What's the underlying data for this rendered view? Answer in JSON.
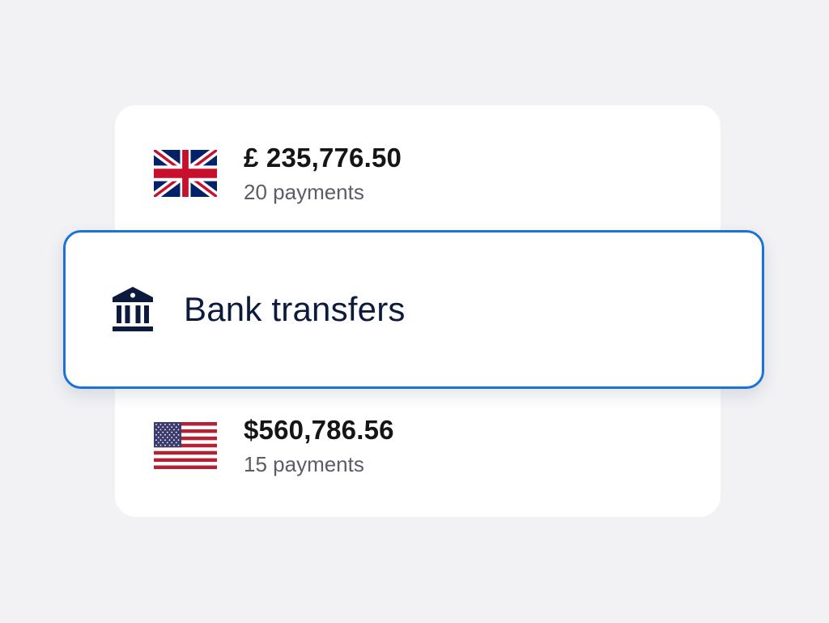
{
  "accounts": [
    {
      "flag": "uk-flag-icon",
      "amount": "£ 235,776.50",
      "payments": "20 payments"
    },
    {
      "flag": "us-flag-icon",
      "amount": "$560,786.56",
      "payments": "15 payments"
    }
  ],
  "payment_method": {
    "icon": "bank-icon",
    "label": "Bank transfers"
  },
  "colors": {
    "background": "#f2f2f5",
    "card": "#ffffff",
    "selected_border": "#1a73d9",
    "bank_icon": "#0c1a3d",
    "amount_text": "#151515",
    "secondary_text": "#5b5d64"
  }
}
